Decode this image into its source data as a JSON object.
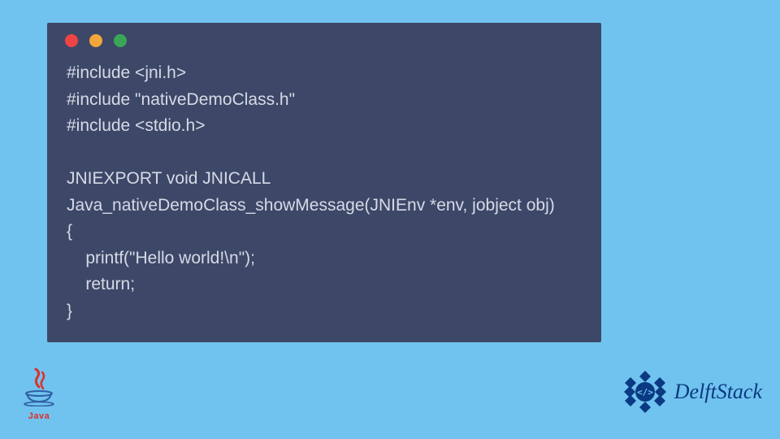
{
  "code": {
    "line1": "#include <jni.h>",
    "line2": "#include \"nativeDemoClass.h\"",
    "line3": "#include <stdio.h>",
    "line4": "",
    "line5": "JNIEXPORT void JNICALL",
    "line6": "Java_nativeDemoClass_showMessage(JNIEnv *env, jobject obj)",
    "line7": "{",
    "line8": "    printf(\"Hello world!\\n\");",
    "line9": "    return;",
    "line10": "}"
  },
  "logos": {
    "java_label": "Java",
    "delftstack_label": "DelftStack"
  },
  "colors": {
    "page_bg": "#71c3ef",
    "window_bg": "#3d4868",
    "code_text": "#d6dae6",
    "dot_red": "#ef4444",
    "dot_yellow": "#f3a73a",
    "dot_green": "#3aa757",
    "java_red": "#d9332a",
    "delft_blue": "#0a3a82"
  }
}
